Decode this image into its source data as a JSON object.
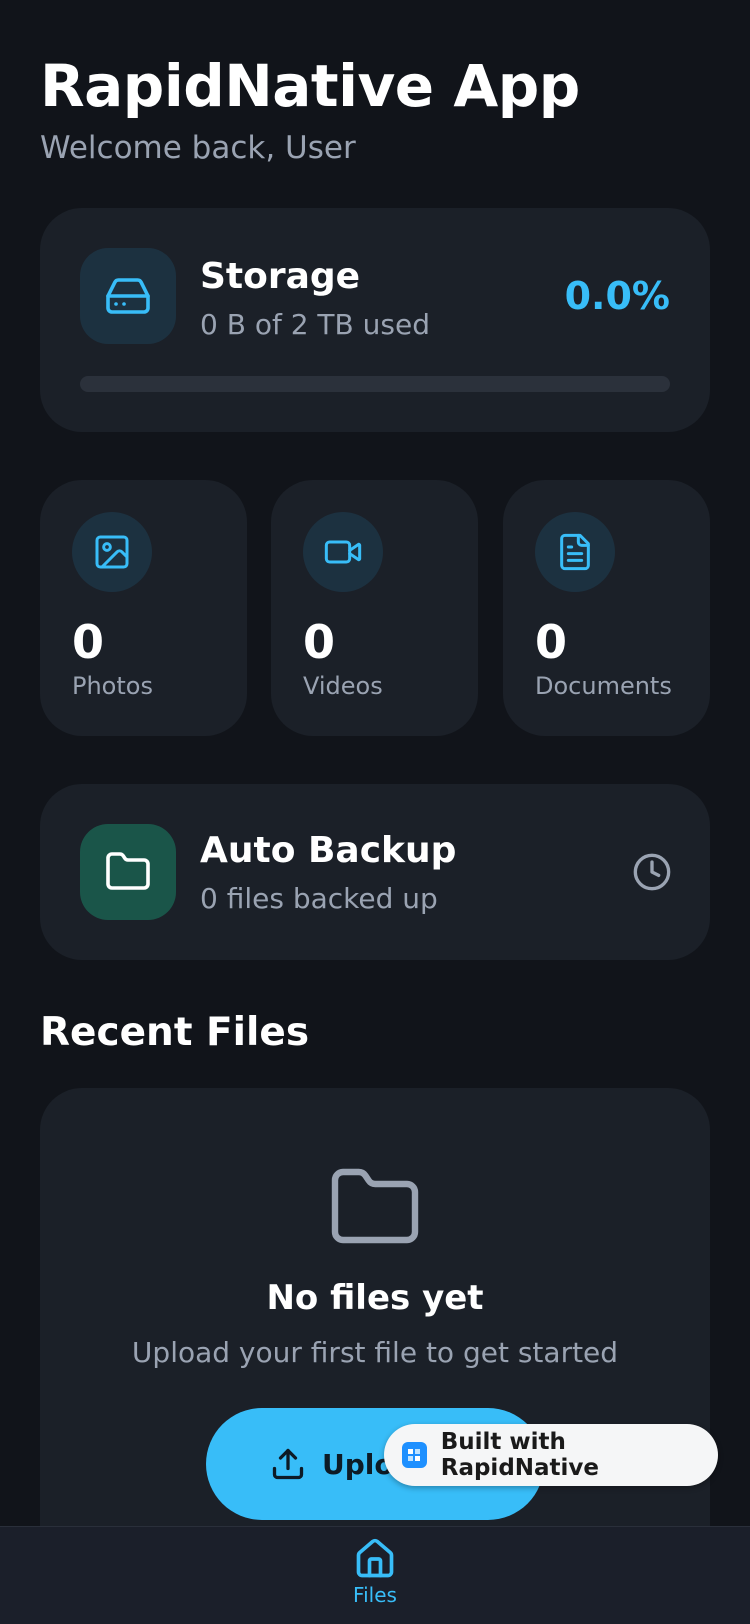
{
  "header": {
    "title": "RapidNative App",
    "subtitle": "Welcome back, User"
  },
  "storage": {
    "title": "Storage",
    "used_text": "0 B of 2 TB used",
    "percent_text": "0.0%",
    "percent_value": 0.0,
    "icon": "hard-drive-icon"
  },
  "stats": [
    {
      "count": "0",
      "label": "Photos",
      "icon": "image-icon"
    },
    {
      "count": "0",
      "label": "Videos",
      "icon": "video-icon"
    },
    {
      "count": "0",
      "label": "Documents",
      "icon": "document-icon"
    }
  ],
  "backup": {
    "title": "Auto Backup",
    "subtitle": "0 files backed up",
    "icon": "folder-icon",
    "action_icon": "clock-icon"
  },
  "recent": {
    "section_title": "Recent Files",
    "empty_title": "No files yet",
    "empty_subtitle": "Upload your first file to get started",
    "upload_label": "Upload File"
  },
  "badge": {
    "label": "Built with RapidNative"
  },
  "tabbar": {
    "files_label": "Files"
  },
  "colors": {
    "accent": "#38bdf8",
    "background": "#11141a",
    "card": "#1b2028",
    "backup_icon_bg": "#1a5549"
  }
}
